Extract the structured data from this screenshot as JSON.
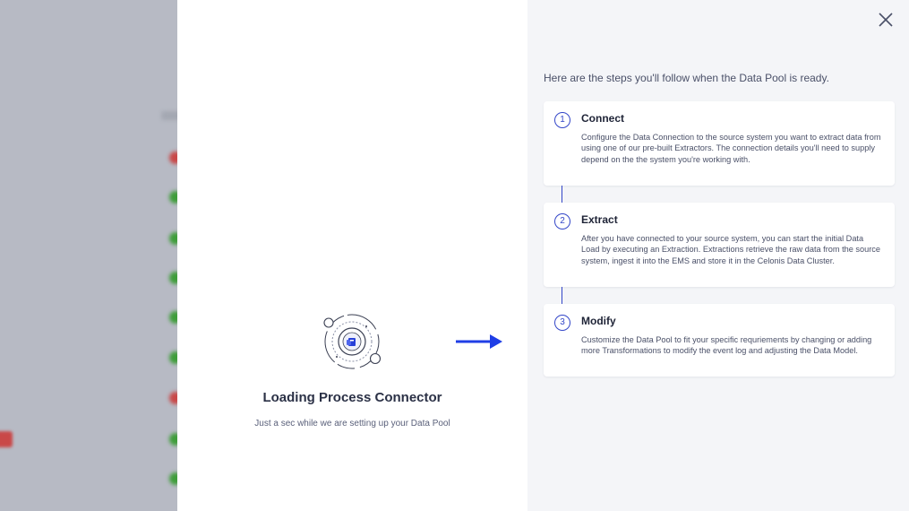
{
  "loading": {
    "title": "Loading Process Connector",
    "subtitle": "Just a sec while we are setting up your Data Pool"
  },
  "steps_panel": {
    "intro": "Here are the steps you'll follow when the Data Pool is ready.",
    "steps": [
      {
        "number": "1",
        "title": "Connect",
        "description": "Configure the Data Connection to the source system you want to extract data from using one of our pre-built Extractors. The connection details you'll need to supply depend on the the system you're working with."
      },
      {
        "number": "2",
        "title": "Extract",
        "description": "After you have connected to your source system, you can start the initial Data Load by executing an Extraction. Extractions retrieve the raw data from the source system, ingest it into the EMS and store it in the Celonis Data Cluster."
      },
      {
        "number": "3",
        "title": "Modify",
        "description": "Customize the Data Pool to fit your specific requriements by changing or adding more Transformations to modify the event log and adjusting the Data Model."
      }
    ]
  },
  "icons": {
    "close": "close-icon",
    "arrow": "arrow-right-icon",
    "loader": "process-connector-loader-icon"
  },
  "colors": {
    "accent": "#3346c8",
    "arrow": "#1f3ee6"
  }
}
